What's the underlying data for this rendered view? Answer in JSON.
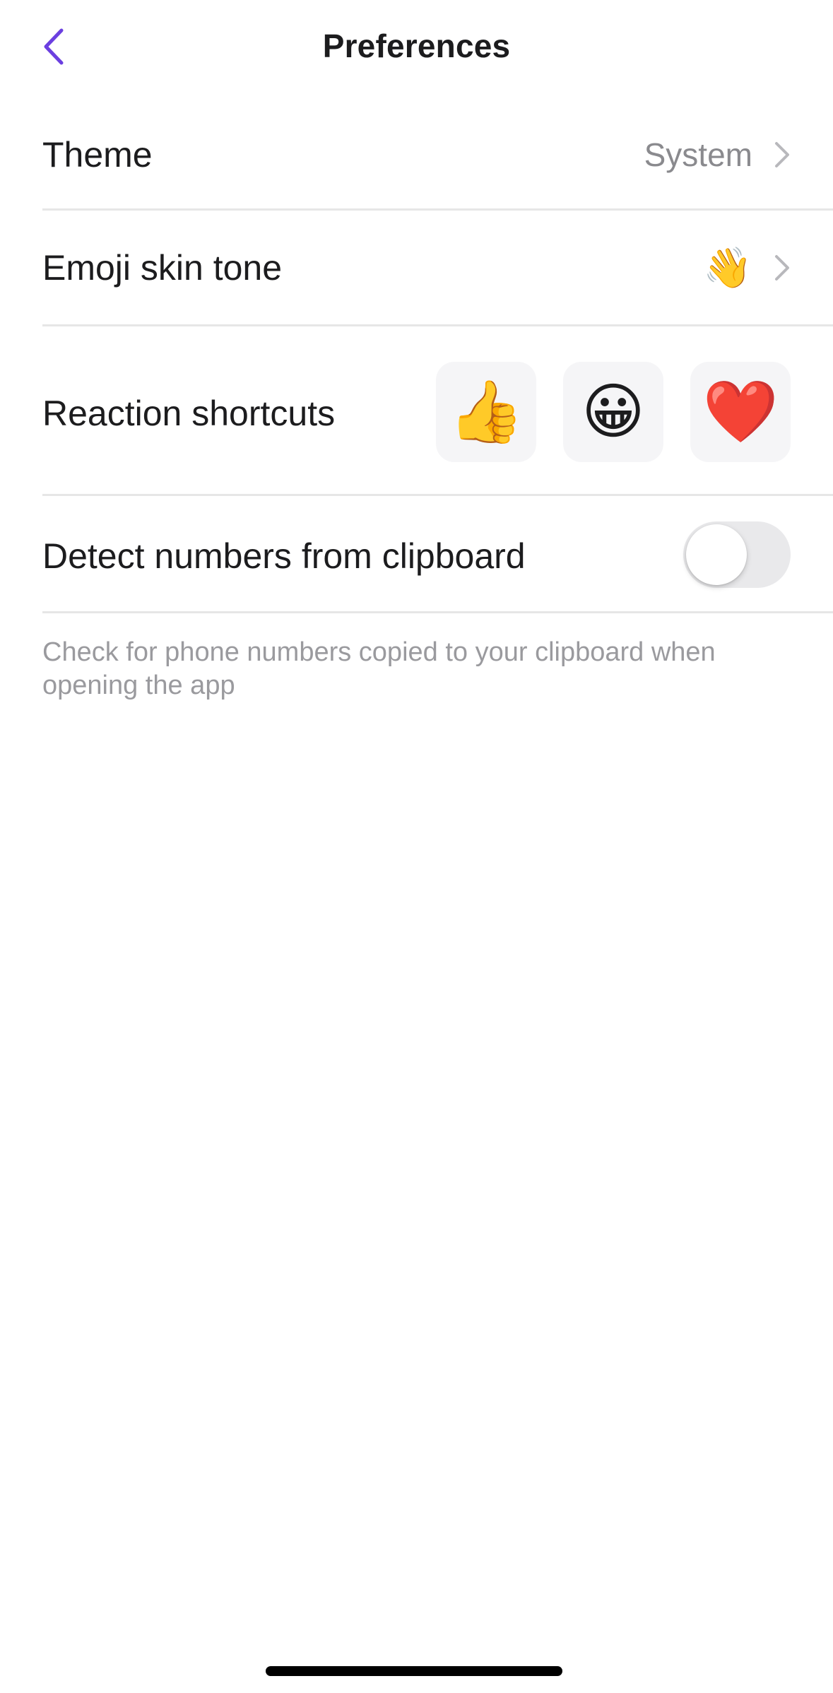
{
  "header": {
    "title": "Preferences",
    "back_icon": "chevron-left-icon",
    "accent_color": "#6B3FE0"
  },
  "settings": {
    "theme": {
      "label": "Theme",
      "value": "System"
    },
    "emoji_skin_tone": {
      "label": "Emoji skin tone",
      "value": "👋"
    },
    "reaction_shortcuts": {
      "label": "Reaction shortcuts",
      "emojis": [
        "👍",
        "😀",
        "❤️"
      ]
    },
    "detect_clipboard": {
      "label": "Detect numbers from clipboard",
      "enabled": false,
      "hint": "Check for phone numbers copied to your clipboard when opening the app"
    }
  }
}
